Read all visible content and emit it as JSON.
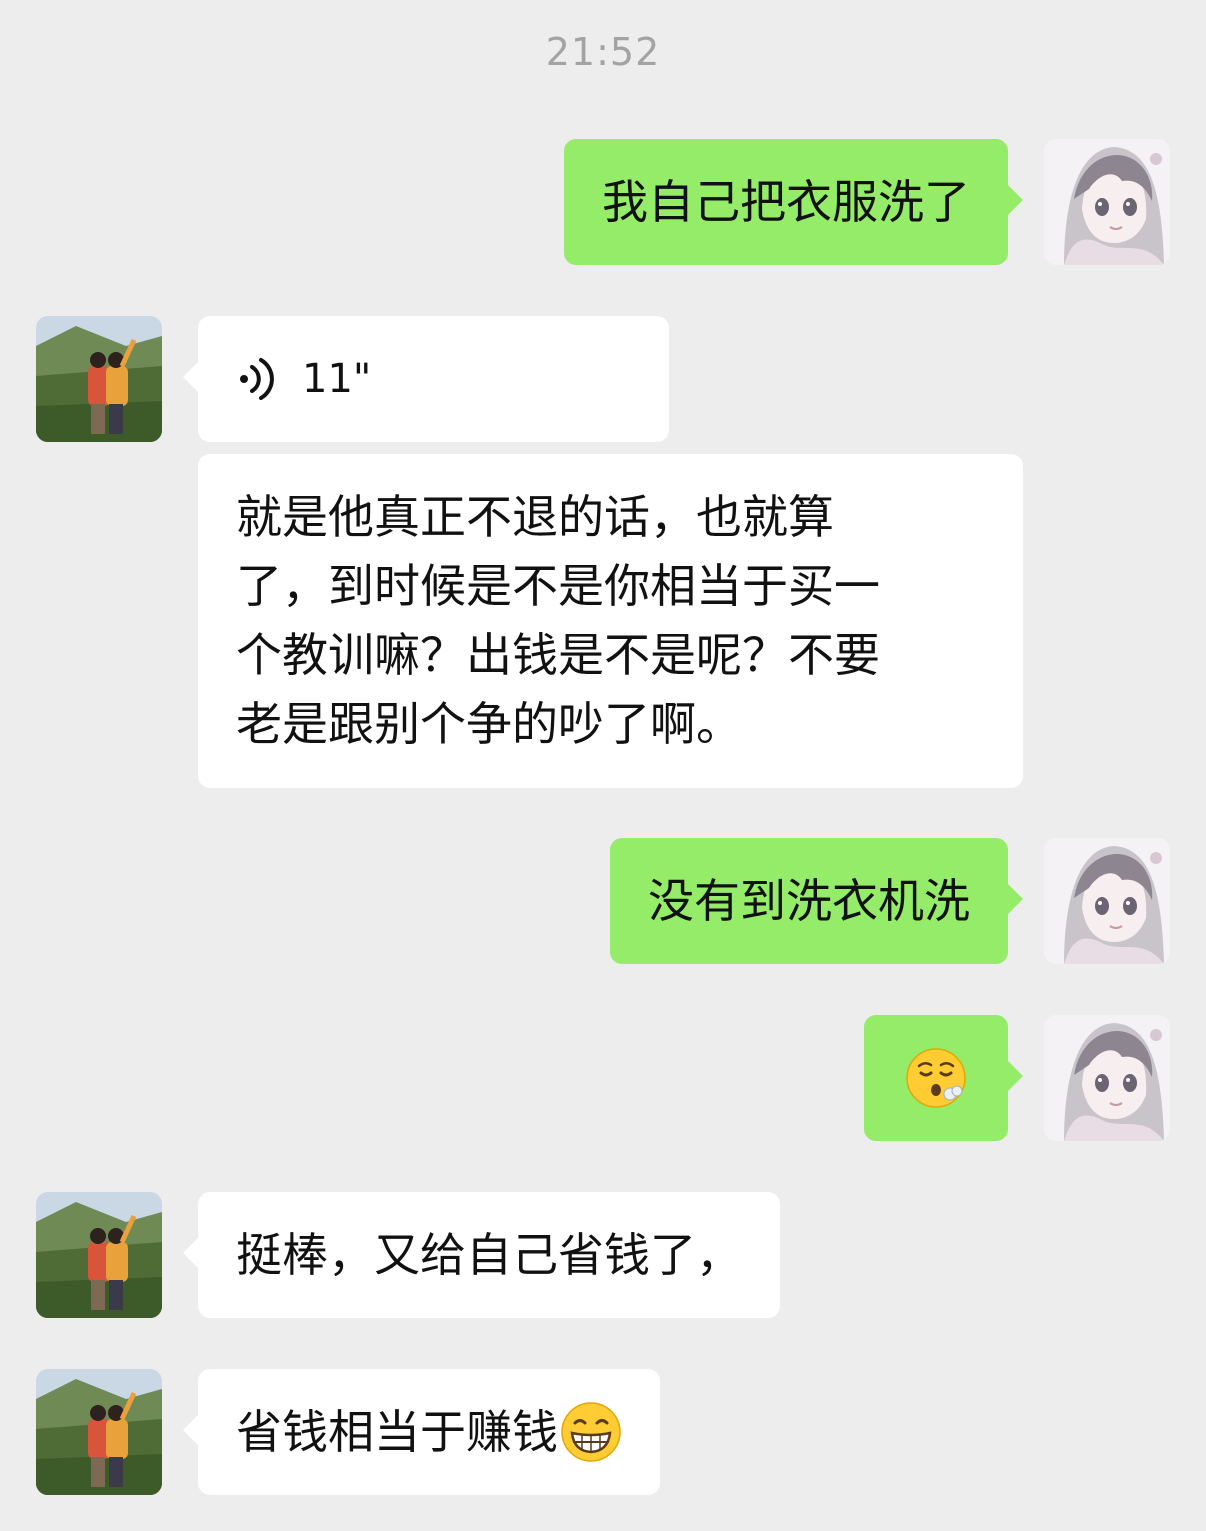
{
  "timestamp": "21:52",
  "messages": [
    {
      "side": "sent",
      "type": "text",
      "text": "我自己把衣服洗了"
    },
    {
      "side": "received",
      "type": "voice",
      "duration": "11\""
    },
    {
      "side": "received",
      "type": "text",
      "lines": [
        "就是他真正不退的话，也就算",
        "了，到时候是不是你相当于买一",
        "个教训嘛？出钱是不是呢？不要",
        "老是跟别个争的吵了啊。"
      ]
    },
    {
      "side": "sent",
      "type": "text",
      "text": "没有到洗衣机洗"
    },
    {
      "side": "sent",
      "type": "emoji",
      "emoji": "😮‍💨",
      "icon": "face-exhaling-emoji"
    },
    {
      "side": "received",
      "type": "text",
      "text": "挺棒，又给自己省钱了，"
    },
    {
      "side": "received",
      "type": "text",
      "text": "省钱相当于赚钱",
      "trailing_emoji": "😁",
      "trailing_icon": "grinning-face-emoji"
    }
  ],
  "colors": {
    "background": "#ededed",
    "sent_bubble": "#95ec69",
    "received_bubble": "#ffffff",
    "timestamp": "#a3a3a3"
  },
  "avatars": {
    "self": "anime-girl-avatar",
    "contact": "two-people-landscape-avatar"
  }
}
